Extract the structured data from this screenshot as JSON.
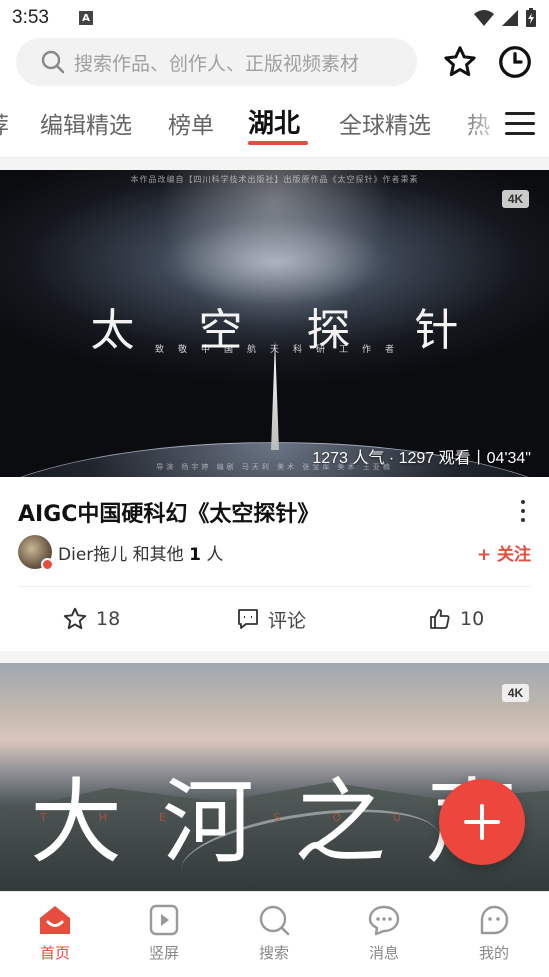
{
  "status_bar": {
    "time": "3:53",
    "badge": "A"
  },
  "search": {
    "placeholder": "搜索作品、创作人、正版视频素材"
  },
  "tabs": [
    {
      "label": "荐"
    },
    {
      "label": "编辑精选"
    },
    {
      "label": "榜单"
    },
    {
      "label": "湖北",
      "active": true
    },
    {
      "label": "全球精选"
    },
    {
      "label": "热"
    }
  ],
  "card1": {
    "thumbnail": {
      "top_text": "本作品改编自【四川科学技术出版社】出版原作品《太空探针》作者秉素",
      "title_text": "太空探针",
      "subtitle_text": "致敬中国航天科研工作者",
      "credits_text": "导演 杨宇婷   编剧 马天利   美术 张宝库   美术 王亚楠",
      "resolution_badge": "4K",
      "meta": "1273 人气 · 1297 观看丨04'34\""
    },
    "title": "AIGC中国硬科幻《太空探针》",
    "author": {
      "name": "Dier拖儿",
      "and_others": "和其他",
      "count": "1",
      "unit": "人"
    },
    "follow_label": "+ 关注",
    "actions": {
      "stars": "18",
      "comment_label": "评论",
      "likes": "10"
    }
  },
  "card2": {
    "thumbnail": {
      "title_text": "大河之声",
      "subtitle_text": "THE SOUND OF RI",
      "resolution_badge": "4K"
    }
  },
  "bottom_nav": [
    {
      "label": "首页",
      "icon": "home-icon",
      "active": true
    },
    {
      "label": "竖屏",
      "icon": "vertical-video-icon"
    },
    {
      "label": "搜索",
      "icon": "search-icon"
    },
    {
      "label": "消息",
      "icon": "message-icon"
    },
    {
      "label": "我的",
      "icon": "profile-icon"
    }
  ],
  "colors": {
    "accent": "#e74c3c",
    "fab": "#ec463d"
  }
}
